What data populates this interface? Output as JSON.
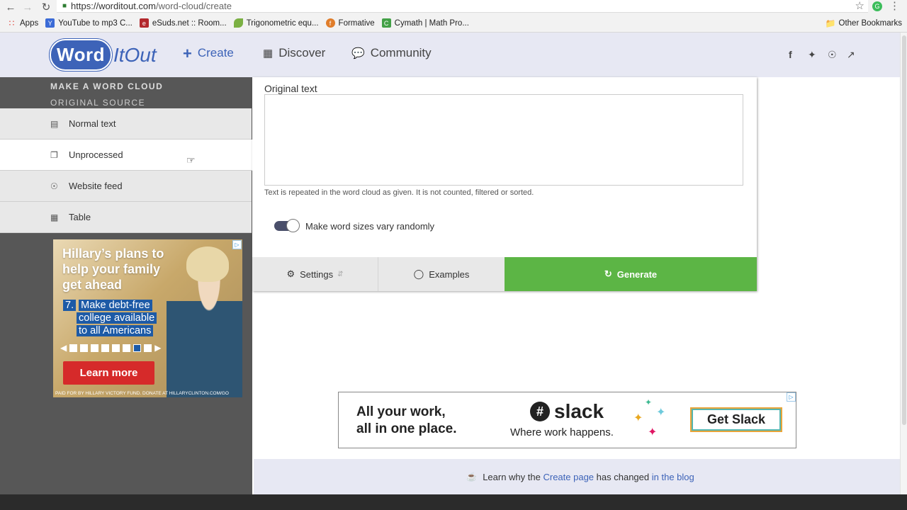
{
  "browser": {
    "url_host": "https://worditout.com",
    "url_path": "/word-cloud/create",
    "bookmarks": [
      {
        "label": "Apps",
        "color": "#e0453b"
      },
      {
        "label": "YouTube to mp3 C...",
        "color": "#3b6bd6"
      },
      {
        "label": "eSuds.net :: Room...",
        "color": "#b3282d"
      },
      {
        "label": "Trigonometric equ...",
        "color": "#7bb043"
      },
      {
        "label": "Formative",
        "color": "#e07d2a"
      },
      {
        "label": "Cymath | Math Pro...",
        "color": "#43a047"
      }
    ],
    "other_bookmarks": "Other Bookmarks"
  },
  "header": {
    "logo_word": "Word",
    "logo_itout": "ItOut",
    "nav": {
      "create": "Create",
      "discover": "Discover",
      "community": "Community"
    },
    "social_icons": [
      "facebook-icon",
      "twitter-icon",
      "rss-icon",
      "share-icon"
    ]
  },
  "sidebar": {
    "heading": "MAKE A WORD CLOUD",
    "subheading": "ORIGINAL SOURCE",
    "items": [
      {
        "label": "Normal text",
        "icon": "document-icon"
      },
      {
        "label": "Unprocessed",
        "icon": "copy-icon"
      },
      {
        "label": "Website feed",
        "icon": "rss-icon"
      },
      {
        "label": "Table",
        "icon": "table-icon"
      }
    ],
    "active_item": "Unprocessed"
  },
  "ad_left": {
    "headline": "Hillary’s plans to help your family get ahead",
    "point_number": "7.",
    "point_line1": "Make debt-free",
    "point_line2": "college available",
    "point_line3": "to all Americans",
    "button": "Learn more",
    "paid_for": "PAID FOR BY HILLARY VICTORY FUND. DONATE AT HILLARYCLINTON.COM/GO",
    "progress_slides_total": 8,
    "progress_slide_active": 7
  },
  "panel": {
    "original_label": "Original text",
    "textarea_value": "",
    "hint": "Text is repeated in the word cloud as given. It is not counted, filtered or sorted.",
    "toggle_label": "Make word sizes vary randomly",
    "toggle_on": true,
    "buttons": {
      "settings": "Settings",
      "examples": "Examples",
      "generate": "Generate"
    }
  },
  "ad_bottom": {
    "tagline1": "All your work,",
    "tagline2": "all in one place.",
    "brand": "slack",
    "sub": "Where work happens.",
    "cta": "Get Slack"
  },
  "footer": {
    "pre": "Learn why the",
    "link1": "Create page",
    "mid": "has changed",
    "link2": "in the blog"
  },
  "colors": {
    "brand_blue": "#3d63b8",
    "generate_green": "#5cb545",
    "sidebar_dark": "#575757",
    "header_bg": "#e7e8f3"
  }
}
